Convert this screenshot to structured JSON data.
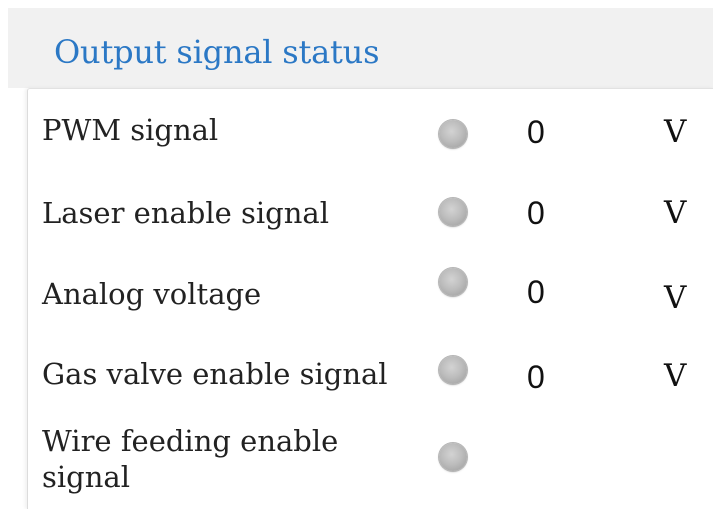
{
  "panel": {
    "title": "Output signal status"
  },
  "signals": [
    {
      "label": "PWM signal",
      "value": "0",
      "unit": "V"
    },
    {
      "label": "Laser enable signal",
      "value": "0",
      "unit": "V"
    },
    {
      "label": "Analog voltage",
      "value": "0",
      "unit": "V"
    },
    {
      "label": "Gas valve enable signal",
      "value": "0",
      "unit": "V"
    },
    {
      "label": "Wire feeding enable signal"
    }
  ],
  "indicator_color": "#b5b5b5",
  "title_color": "#2b78c5"
}
